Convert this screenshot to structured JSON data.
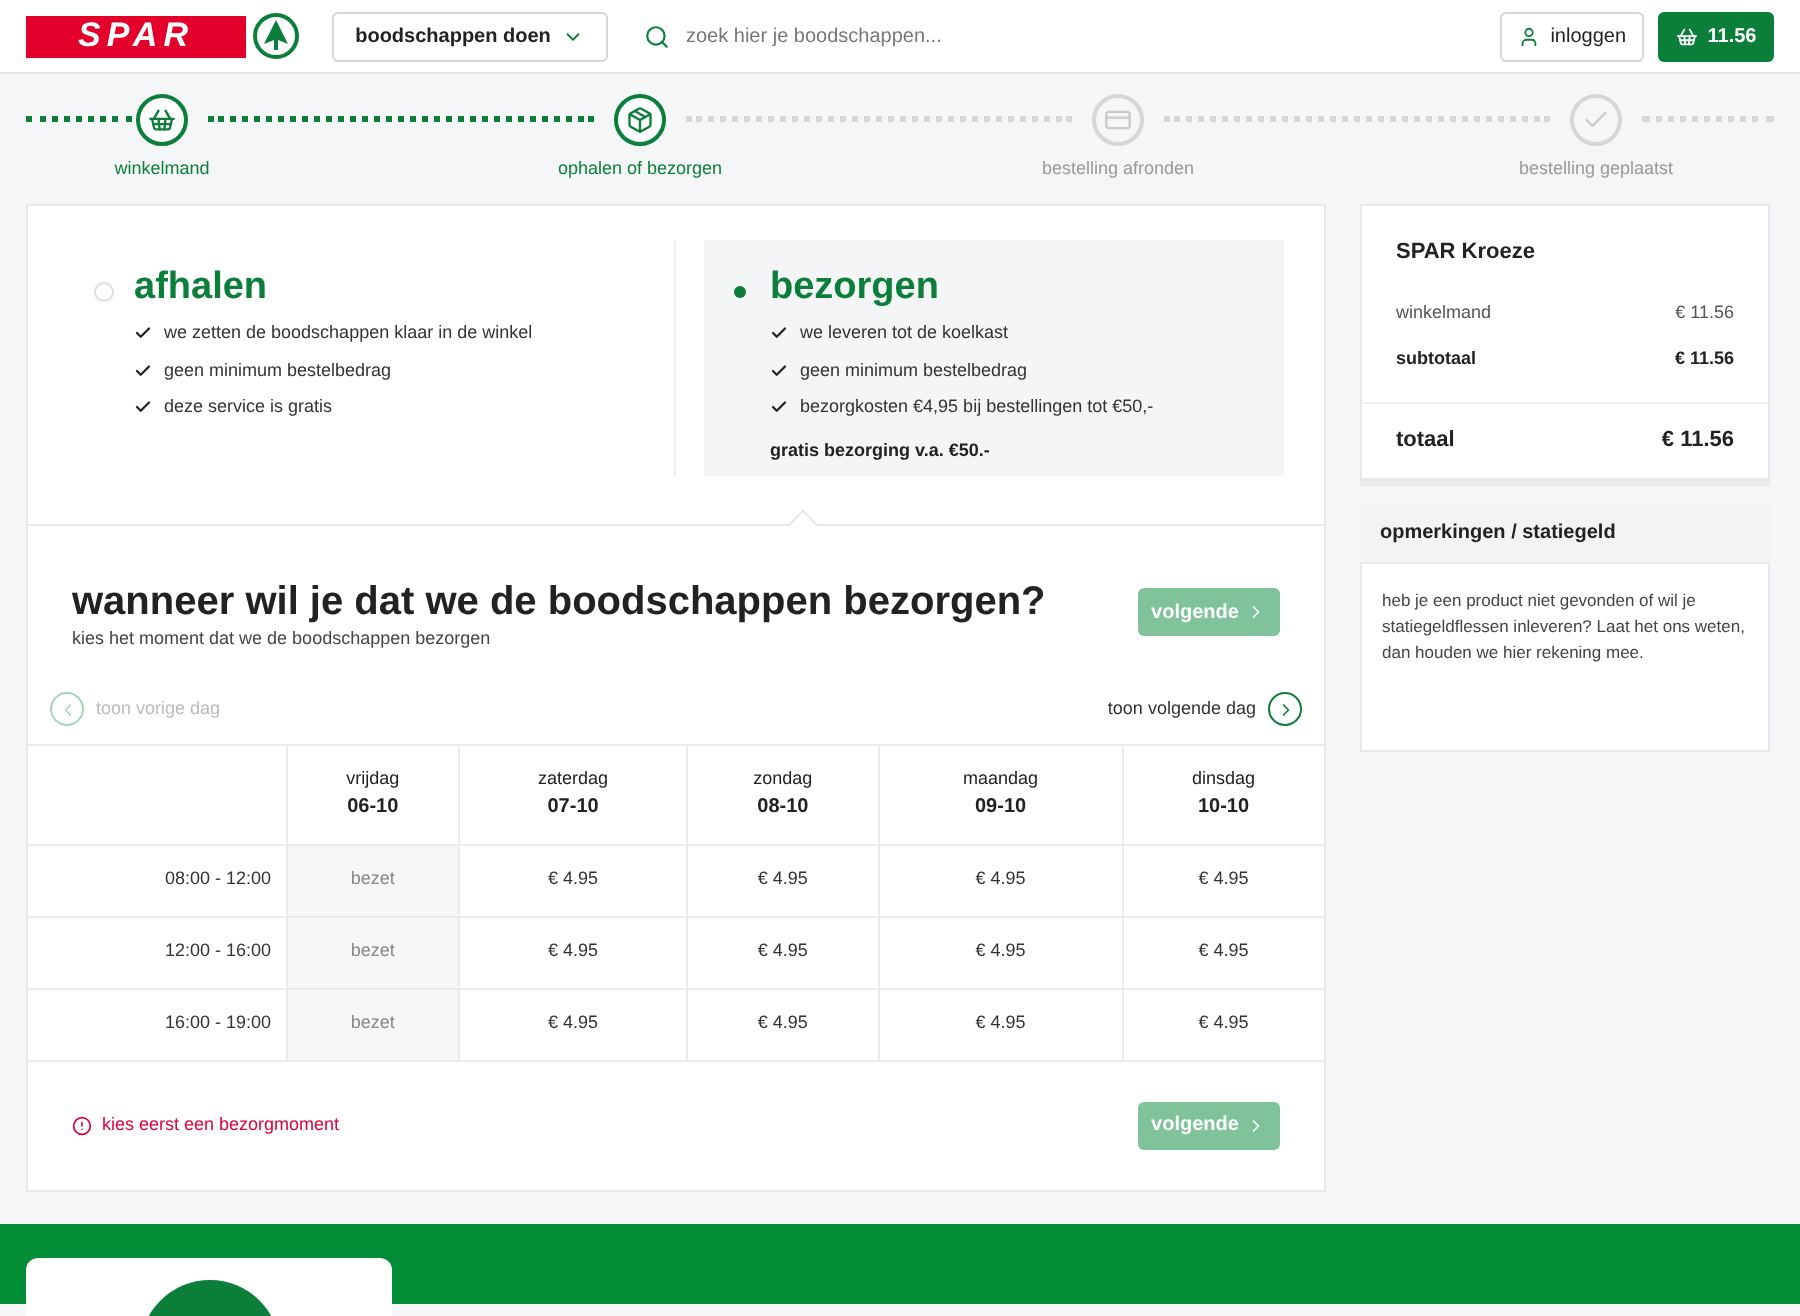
{
  "header": {
    "logo_text": "SPAR",
    "menu_button": "boodschappen doen",
    "search": {
      "placeholder": "zoek hier je boodschappen..."
    },
    "login_button": "inloggen",
    "cart_button": "11.56"
  },
  "steps": [
    {
      "label": "winkelmand",
      "reached": true
    },
    {
      "label": "ophalen of bezorgen",
      "reached": true
    },
    {
      "label": "bestelling afronden",
      "reached": false
    },
    {
      "label": "bestelling geplaatst",
      "reached": false
    }
  ],
  "options": [
    {
      "title": "afhalen",
      "selected": false,
      "features": [
        "we zetten de boodschappen klaar in de winkel",
        "geen minimum bestelbedrag",
        "deze service is gratis"
      ]
    },
    {
      "title": "bezorgen",
      "selected": true,
      "features": [
        "we leveren tot de koelkast",
        "geen minimum bestelbedrag",
        "bezorgkosten €4,95 bij bestellingen tot €50,-"
      ],
      "note": "gratis bezorging v.a. €50.-"
    }
  ],
  "schedule": {
    "title": "wanneer wil je dat we de boodschappen bezorgen?",
    "subtitle": "kies het moment dat we de boodschappen bezorgen",
    "next_button": "volgende",
    "next_disabled": true,
    "prev_day": {
      "label": "toon vorige dag",
      "disabled": true
    },
    "next_day": {
      "label": "toon volgende dag",
      "disabled": false
    },
    "days": [
      {
        "name": "vrijdag",
        "date": "06-10"
      },
      {
        "name": "zaterdag",
        "date": "07-10"
      },
      {
        "name": "zondag",
        "date": "08-10"
      },
      {
        "name": "maandag",
        "date": "09-10"
      },
      {
        "name": "dinsdag",
        "date": "10-10"
      }
    ],
    "rows": [
      {
        "time": "08:00 - 12:00",
        "cells": [
          {
            "text": "bezet",
            "available": false
          },
          {
            "text": "€ 4.95",
            "available": true
          },
          {
            "text": "€ 4.95",
            "available": true
          },
          {
            "text": "€ 4.95",
            "available": true
          },
          {
            "text": "€ 4.95",
            "available": true
          }
        ]
      },
      {
        "time": "12:00 - 16:00",
        "cells": [
          {
            "text": "bezet",
            "available": false
          },
          {
            "text": "€ 4.95",
            "available": true
          },
          {
            "text": "€ 4.95",
            "available": true
          },
          {
            "text": "€ 4.95",
            "available": true
          },
          {
            "text": "€ 4.95",
            "available": true
          }
        ]
      },
      {
        "time": "16:00 - 19:00",
        "cells": [
          {
            "text": "bezet",
            "available": false
          },
          {
            "text": "€ 4.95",
            "available": true
          },
          {
            "text": "€ 4.95",
            "available": true
          },
          {
            "text": "€ 4.95",
            "available": true
          },
          {
            "text": "€ 4.95",
            "available": true
          }
        ]
      }
    ],
    "error": "kies eerst een bezorgmoment",
    "bottom_button": "volgende"
  },
  "summary": {
    "store": "SPAR Kroeze",
    "lines": [
      {
        "label": "winkelmand",
        "value": "€ 11.56",
        "kind": "normal"
      },
      {
        "label": "subtotaal",
        "value": "€ 11.56",
        "kind": "bold"
      }
    ],
    "total_label": "totaal",
    "total_value": "€ 11.56"
  },
  "remarks": {
    "title": "opmerkingen / statiegeld",
    "text": "heb je een product niet gevonden of wil je statiegeldflessen inleveren? Laat het ons weten, dan houden we hier rekening mee."
  }
}
